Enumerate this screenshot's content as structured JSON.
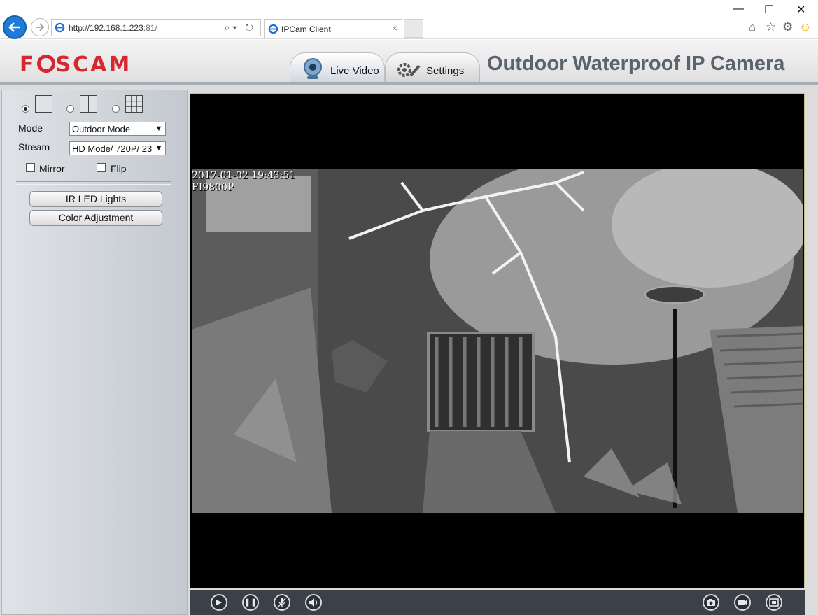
{
  "browser": {
    "url_host": "http://192.168.1.223",
    "url_port": ":81/",
    "tab_title": "IPCam Client",
    "tab_close": "×",
    "min": "—",
    "max": "☐",
    "close": "✕",
    "addr_tools": "⌕▾ ↻",
    "fav_icons": [
      "⌂",
      "☆",
      "⚙",
      "☺"
    ]
  },
  "header": {
    "brand": "FOSCAM",
    "tabs": [
      {
        "label": "Live Video",
        "icon": "webcam-icon"
      },
      {
        "label": "Settings",
        "icon": "wrench-gear-icon"
      }
    ],
    "camera_title": "Outdoor Waterproof IP Camera"
  },
  "sidebar": {
    "layouts": [
      {
        "name": "single-view",
        "selected": true
      },
      {
        "name": "quad-view",
        "selected": false
      },
      {
        "name": "nine-view",
        "selected": false
      }
    ],
    "mode_label": "Mode",
    "mode_value": "Outdoor Mode",
    "stream_label": "Stream",
    "stream_value": "HD Mode/ 720P/ 23",
    "mirror_label": "Mirror",
    "flip_label": "Flip",
    "ir_button": "IR LED Lights",
    "color_button": "Color Adjustment"
  },
  "video": {
    "timestamp": "2017-01-02 19:43:51",
    "camera_name": "FI9800P"
  },
  "controls": {
    "left": [
      "play-icon",
      "pause-icon",
      "mic-icon",
      "speaker-icon"
    ],
    "right": [
      "snapshot-icon",
      "record-icon",
      "fullscreen-icon"
    ]
  },
  "colors": {
    "brand_red": "#d7262d",
    "title_gray": "#5a6470",
    "control_bar": "#3b4148"
  }
}
